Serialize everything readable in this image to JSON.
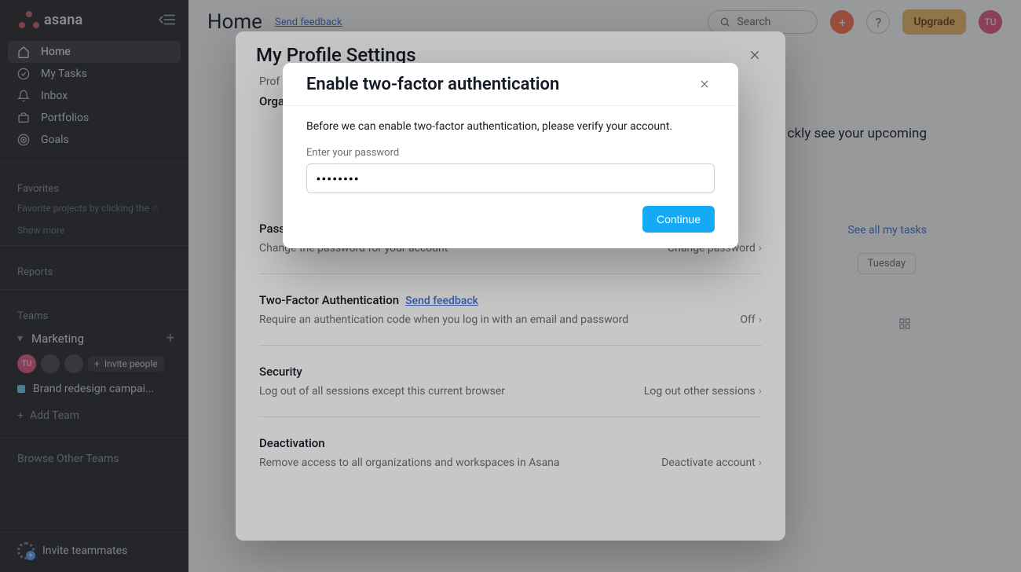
{
  "app": {
    "name": "asana"
  },
  "sidebar": {
    "nav": [
      {
        "label": "Home"
      },
      {
        "label": "My Tasks"
      },
      {
        "label": "Inbox"
      },
      {
        "label": "Portfolios"
      },
      {
        "label": "Goals"
      }
    ],
    "favorites_label": "Favorites",
    "favorites_hint": "Favorite projects by clicking the",
    "show_more": "Show more",
    "reports_label": "Reports",
    "teams_label": "Teams",
    "team_name": "Marketing",
    "invite_people": "Invite people",
    "project_name": "Brand redesign campai...",
    "add_team": "Add Team",
    "browse_other": "Browse Other Teams",
    "invite_teammates": "Invite teammates",
    "user_initials": "TU"
  },
  "topbar": {
    "title": "Home",
    "send_feedback": "Send feedback",
    "search_placeholder": "Search",
    "upgrade": "Upgrade",
    "user_initials": "TU"
  },
  "background": {
    "upcoming_fragment": "ckly see your upcoming",
    "see_all": "See all my tasks",
    "tuesday": "Tuesday"
  },
  "settings": {
    "title": "My Profile Settings",
    "tabstrip_prefix": "Prof",
    "org_prefix": "Orga",
    "password": {
      "heading_prefix": "Pass",
      "desc": "Change the password for your account",
      "action": "Change password"
    },
    "tfa": {
      "heading": "Two-Factor Authentication",
      "feedback": "Send feedback",
      "desc": "Require an authentication code when you log in with an email and password",
      "status": "Off"
    },
    "security": {
      "heading": "Security",
      "desc": "Log out of all sessions except this current browser",
      "action": "Log out other sessions"
    },
    "deactivation": {
      "heading": "Deactivation",
      "desc": "Remove access to all organizations and workspaces in Asana",
      "action": "Deactivate account"
    }
  },
  "dialog": {
    "title": "Enable two-factor authentication",
    "body": "Before we can enable two-factor authentication, please verify your account.",
    "field_label": "Enter your password",
    "password_value": "••••••••",
    "continue": "Continue"
  }
}
